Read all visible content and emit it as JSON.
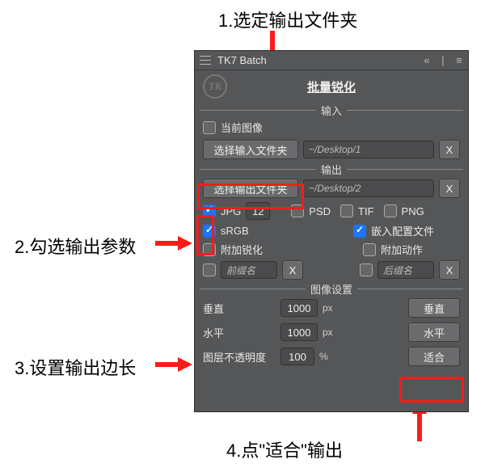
{
  "annotations": {
    "a1": "1.选定输出文件夹",
    "a2": "2.勾选输出参数",
    "a3": "3.设置输出边长",
    "a4": "4.点\"适合\"输出"
  },
  "titlebar": {
    "title": "TK7 Batch"
  },
  "logo": {
    "text": "TK",
    "subtitle": "批量锐化"
  },
  "sections": {
    "input": "输入",
    "output": "输出",
    "image_settings": "图像设置"
  },
  "input": {
    "current_image": "当前图像",
    "choose_folder_btn": "选择输入文件夹",
    "path": "~/Desktop/1",
    "clear": "X"
  },
  "output": {
    "choose_folder_btn": "选择输出文件夹",
    "path": "~/Desktop/2",
    "clear": "X",
    "fmt_jpg": "JPG",
    "jpg_q": "12",
    "fmt_psd": "PSD",
    "fmt_tif": "TIF",
    "fmt_png": "PNG",
    "srgb": "sRGB",
    "embed_profile": "嵌入配置文件",
    "extra_sharpen": "附加锐化",
    "extra_action": "附加动作",
    "prefix_ph": "前缀名",
    "suffix_ph": "后缀名"
  },
  "image_settings": {
    "vertical_lbl": "垂直",
    "vertical_val": "1000",
    "vertical_unit": "px",
    "vertical_btn": "垂直",
    "horizontal_lbl": "水平",
    "horizontal_val": "1000",
    "horizontal_unit": "px",
    "horizontal_btn": "水平",
    "opacity_lbl": "图层不透明度",
    "opacity_val": "100",
    "opacity_unit": "%",
    "fit_btn": "适合"
  }
}
